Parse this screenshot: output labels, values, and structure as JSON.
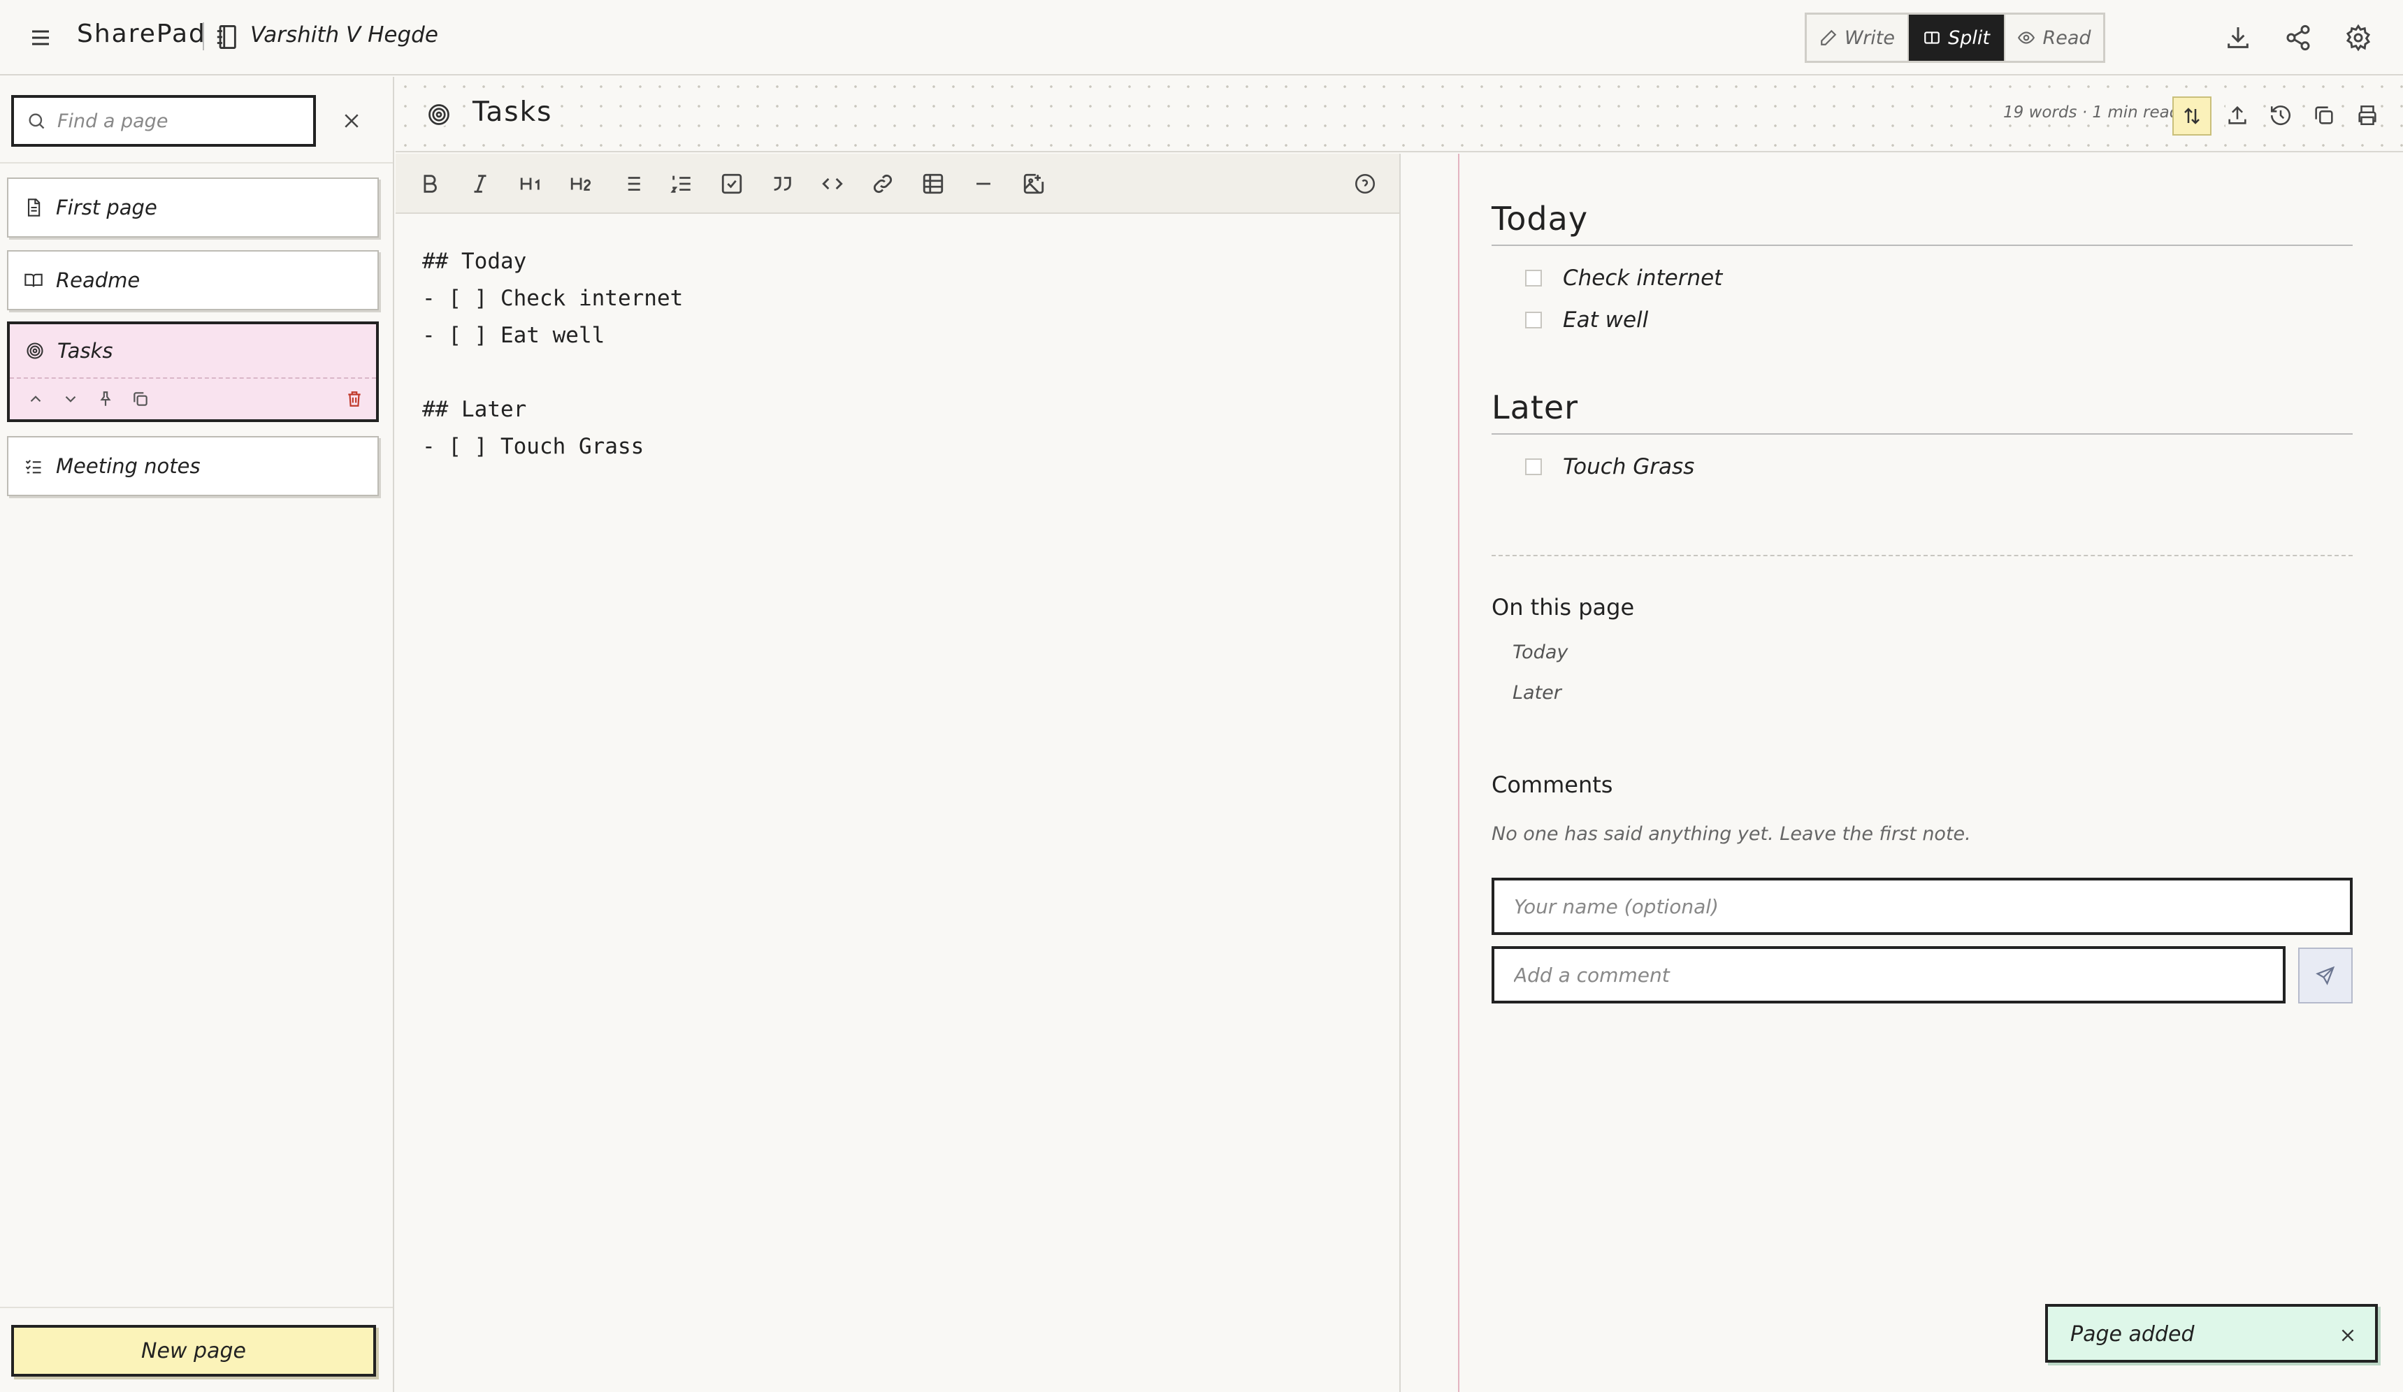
{
  "app": {
    "name": "SharePad",
    "owner": "Varshith V Hegde"
  },
  "modes": [
    {
      "label": "Write",
      "icon": "pencil-icon",
      "active": false
    },
    {
      "label": "Split",
      "icon": "split-icon",
      "active": true
    },
    {
      "label": "Read",
      "icon": "eye-icon",
      "active": false
    }
  ],
  "top_actions": [
    "download-icon",
    "share-icon",
    "settings-icon"
  ],
  "sidebar": {
    "search_placeholder": "Find a page",
    "pages": [
      {
        "label": "First page",
        "icon": "document-icon",
        "selected": false
      },
      {
        "label": "Readme",
        "icon": "book-open-icon",
        "selected": false
      },
      {
        "label": "Tasks",
        "icon": "target-icon",
        "selected": true
      },
      {
        "label": "Meeting notes",
        "icon": "list-checks-icon",
        "selected": false
      }
    ],
    "new_page_label": "New page"
  },
  "document": {
    "title": "Tasks",
    "stats": "19 words · 1 min read",
    "markdown": "## Today\n- [ ] Check internet\n- [ ] Eat well\n\n## Later\n- [ ] Touch Grass"
  },
  "preview": {
    "sections": [
      {
        "heading": "Today",
        "tasks": [
          "Check internet",
          "Eat well"
        ]
      },
      {
        "heading": "Later",
        "tasks": [
          "Touch Grass"
        ]
      }
    ],
    "toc_title": "On this page",
    "toc": [
      "Today",
      "Later"
    ],
    "comments_title": "Comments",
    "comments_empty": "No one has said anything yet. Leave the first note.",
    "name_placeholder": "Your name (optional)",
    "comment_placeholder": "Add a comment"
  },
  "toast": {
    "message": "Page added"
  },
  "colors": {
    "background": "#f9f8f5",
    "selected_page": "#f9e3ef",
    "accent_yellow": "#fbf3b9",
    "toast_green": "#def7e9",
    "active_mode": "#1f1f1f"
  }
}
